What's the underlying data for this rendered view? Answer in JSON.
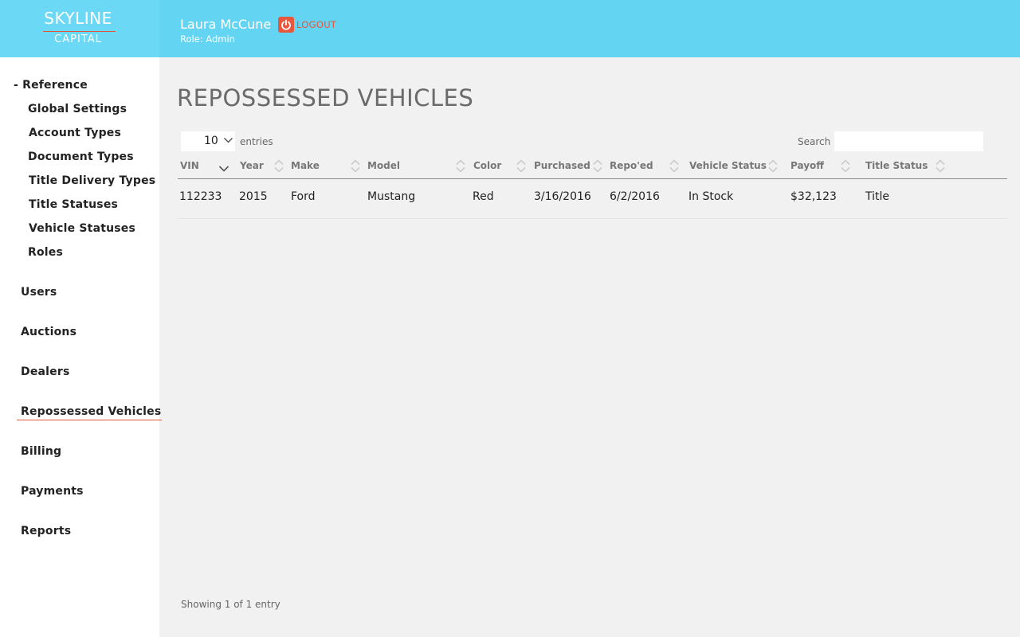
{
  "app": {
    "logo_top": "SKYLINE",
    "logo_bottom": "CAPITAL",
    "user_name": "Laura McCune",
    "user_role": "Role: Admin",
    "logout_label": "LOGOUT"
  },
  "sidebar": {
    "reference_label": "- Reference",
    "reference_items": [
      {
        "label": "Global Settings"
      },
      {
        "label": "Account Types"
      },
      {
        "label": "Document Types"
      },
      {
        "label": "Title Delivery Types"
      },
      {
        "label": "Title Statuses"
      },
      {
        "label": "Vehicle Statuses"
      },
      {
        "label": "Roles"
      }
    ],
    "items": [
      {
        "label": "Users"
      },
      {
        "label": "Auctions"
      },
      {
        "label": "Dealers"
      },
      {
        "label": "Repossessed Vehicles",
        "active": true
      },
      {
        "label": "Billing"
      },
      {
        "label": "Payments"
      },
      {
        "label": "Reports"
      }
    ]
  },
  "main": {
    "title": "REPOSSESSED VEHICLES",
    "entries_value": "10",
    "entries_label": "entries",
    "search_label": "Search",
    "search_value": "",
    "columns": [
      "VIN",
      "Year",
      "Make",
      "Model",
      "Color",
      "Purchased",
      "Repo'ed",
      "Vehicle Status",
      "Payoff",
      "Title Status"
    ],
    "sorted_column": "VIN",
    "sort_direction": "descending",
    "rows": [
      [
        "112233",
        "2015",
        "Ford",
        "Mustang",
        "Red",
        "3/16/2016",
        "6/2/2016",
        "In Stock",
        "$32,123",
        "Title"
      ]
    ],
    "info": "Showing 1 of 1 entry"
  },
  "colors": {
    "header_bg": "#63d5f3",
    "accent_red": "#e8563c",
    "page_bg": "#f1f1f1",
    "sidebar_bg": "#ffffff"
  },
  "icons": {
    "logout": "power-icon",
    "sort": "sort-both-icon",
    "sorted": "sort-desc-icon",
    "select": "chevron-down-icon"
  }
}
